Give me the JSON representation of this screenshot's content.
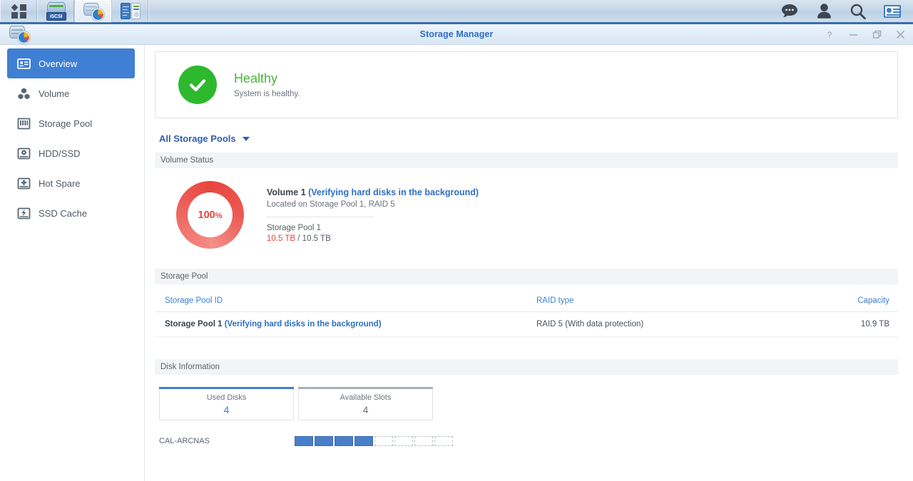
{
  "taskbar": {
    "buttons": [
      {
        "name": "app-launcher",
        "icon": "grid-launcher-icon",
        "active": false
      },
      {
        "name": "iscsi-manager",
        "icon": "iscsi-icon",
        "label": "iSCSI",
        "active": false
      },
      {
        "name": "storage-manager",
        "icon": "storage-manager-icon",
        "active": true
      },
      {
        "name": "log-center",
        "icon": "log-center-icon",
        "active": false
      }
    ],
    "tray": [
      {
        "name": "notifications",
        "icon": "chat-bubble-icon"
      },
      {
        "name": "user-menu",
        "icon": "person-icon"
      },
      {
        "name": "search",
        "icon": "magnifier-icon"
      },
      {
        "name": "widgets",
        "icon": "id-card-icon"
      }
    ]
  },
  "window": {
    "title": "Storage Manager",
    "icon": "storage-manager-icon",
    "controls": [
      {
        "name": "help-button",
        "icon": "question-mark-icon",
        "glyph": "?"
      },
      {
        "name": "minimize-button",
        "icon": "minimize-icon",
        "glyph": "–"
      },
      {
        "name": "maximize-button",
        "icon": "maximize-icon",
        "glyph": "❐"
      },
      {
        "name": "close-button",
        "icon": "close-icon",
        "glyph": "✕"
      }
    ]
  },
  "sidebar": {
    "items": [
      {
        "label": "Overview",
        "icon": "overview-card-icon",
        "active": true
      },
      {
        "label": "Volume",
        "icon": "volume-cubes-icon",
        "active": false
      },
      {
        "label": "Storage Pool",
        "icon": "storage-pool-icon",
        "active": false
      },
      {
        "label": "HDD/SSD",
        "icon": "hdd-disk-icon",
        "active": false
      },
      {
        "label": "Hot Spare",
        "icon": "hot-spare-plus-icon",
        "active": false
      },
      {
        "label": "SSD Cache",
        "icon": "ssd-cache-bolt-icon",
        "active": false
      }
    ]
  },
  "health": {
    "icon": "green-checkmark-icon",
    "title": "Healthy",
    "subtitle": "System is healthy.",
    "color": "#4cb338"
  },
  "pool_selector": {
    "label": "All Storage Pools",
    "icon": "chevron-down-icon"
  },
  "volume_status": {
    "section_title": "Volume Status",
    "usage_percent": "100",
    "usage_percent_symbol": "%",
    "volume_name": "Volume 1 ",
    "volume_state": "(Verifying hard disks in the background)",
    "location": "Located on Storage Pool 1, RAID 5",
    "pool_name": "Storage Pool 1",
    "used": "10.5 TB",
    "usage_separator": " / ",
    "total": "10.5 TB",
    "used_color": "#e8453f"
  },
  "storage_pool": {
    "section_title": "Storage Pool",
    "columns": {
      "id": "Storage Pool ID",
      "raid": "RAID type",
      "capacity": "Capacity"
    },
    "rows": [
      {
        "id": "Storage Pool 1 ",
        "id_state": "(Verifying hard disks in the background)",
        "raid": "RAID 5 (With data protection)",
        "capacity": "10.9 TB"
      }
    ]
  },
  "disk_information": {
    "section_title": "Disk Information",
    "cards": [
      {
        "caption": "Used Disks",
        "value": "4",
        "accent": "#3f7fd4"
      },
      {
        "caption": "Available Slots",
        "value": "4",
        "accent": "#a9b0b7"
      }
    ],
    "enclosure_name": "CAL-ARCNAS",
    "slots": [
      {
        "state": "used"
      },
      {
        "state": "used"
      },
      {
        "state": "used"
      },
      {
        "state": "used"
      },
      {
        "state": "empty"
      },
      {
        "state": "empty"
      },
      {
        "state": "empty"
      },
      {
        "state": "empty"
      }
    ]
  }
}
